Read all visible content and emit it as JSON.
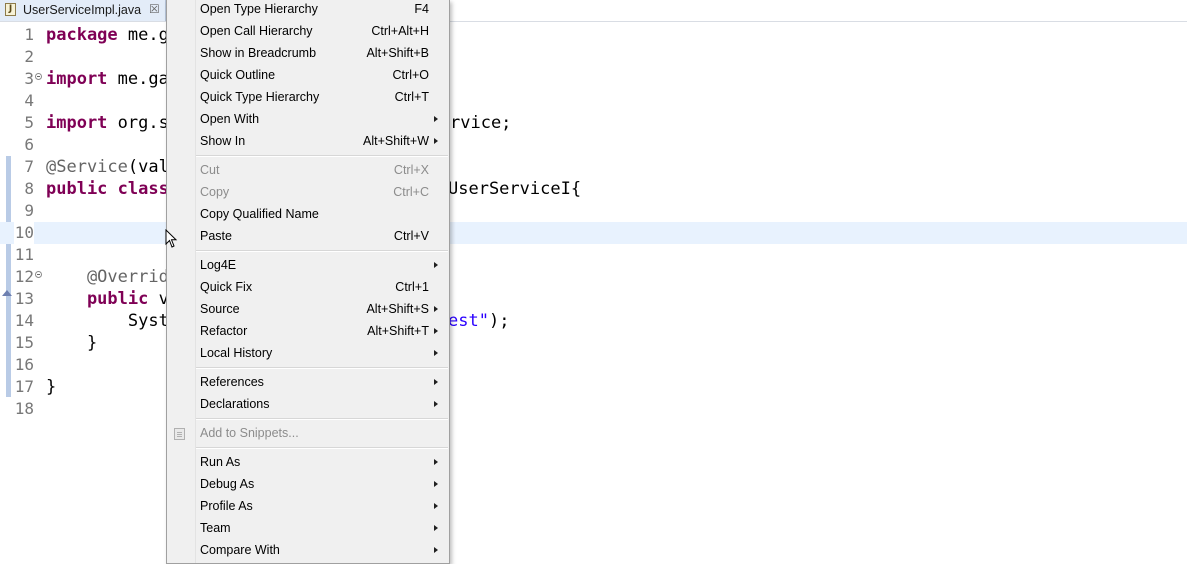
{
  "tab": {
    "label": "UserServiceImpl.java",
    "close_glyph": "☒",
    "file_glyph": "J"
  },
  "lines": [
    {
      "no": "1",
      "prefix": "package",
      "rest": " me.g"
    },
    {
      "no": "2"
    },
    {
      "no": "3",
      "prefix": "import",
      "rest": " me.ga"
    },
    {
      "no": "4"
    },
    {
      "no": "5",
      "prefix": "import",
      "rest": " org.s",
      "tail": "rvice;"
    },
    {
      "no": "6"
    },
    {
      "no": "7",
      "ann": "@Service",
      "rest": "(val"
    },
    {
      "no": "8",
      "prefix": "public",
      "prefix2": " class",
      "tail": "UserServiceI{"
    },
    {
      "no": "9"
    },
    {
      "no": "10"
    },
    {
      "no": "11"
    },
    {
      "no": "12",
      "ann": "    @Overrid"
    },
    {
      "no": "13",
      "prefix": "    public",
      "rest": " v"
    },
    {
      "no": "14",
      "rest": "        Syst",
      "tail_str": "est\"",
      "tail": ");"
    },
    {
      "no": "15",
      "rest": "    }"
    },
    {
      "no": "16"
    },
    {
      "no": "17",
      "rest": "}"
    },
    {
      "no": "18"
    }
  ],
  "menu": {
    "open_type_hierarchy": {
      "label": "Open Type Hierarchy",
      "shortcut": "F4"
    },
    "open_call_hierarchy": {
      "label": "Open Call Hierarchy",
      "shortcut": "Ctrl+Alt+H"
    },
    "show_in_breadcrumb": {
      "label": "Show in Breadcrumb",
      "shortcut": "Alt+Shift+B"
    },
    "quick_outline": {
      "label": "Quick Outline",
      "shortcut": "Ctrl+O"
    },
    "quick_type_hierarchy": {
      "label": "Quick Type Hierarchy",
      "shortcut": "Ctrl+T"
    },
    "open_with": {
      "label": "Open With"
    },
    "show_in": {
      "label": "Show In",
      "shortcut": "Alt+Shift+W"
    },
    "cut": {
      "label": "Cut",
      "shortcut": "Ctrl+X"
    },
    "copy": {
      "label": "Copy",
      "shortcut": "Ctrl+C"
    },
    "copy_qualified_name": {
      "label": "Copy Qualified Name"
    },
    "paste": {
      "label": "Paste",
      "shortcut": "Ctrl+V"
    },
    "log4e": {
      "label": "Log4E"
    },
    "quick_fix": {
      "label": "Quick Fix",
      "shortcut": "Ctrl+1"
    },
    "source": {
      "label": "Source",
      "shortcut": "Alt+Shift+S"
    },
    "refactor": {
      "label": "Refactor",
      "shortcut": "Alt+Shift+T"
    },
    "local_history": {
      "label": "Local History"
    },
    "references": {
      "label": "References"
    },
    "declarations": {
      "label": "Declarations"
    },
    "add_to_snippets": {
      "label": "Add to Snippets..."
    },
    "run_as": {
      "label": "Run As"
    },
    "debug_as": {
      "label": "Debug As"
    },
    "profile_as": {
      "label": "Profile As"
    },
    "team": {
      "label": "Team"
    },
    "compare_with": {
      "label": "Compare With"
    }
  },
  "colors": {
    "keyword": "#7f0055",
    "annotation": "#646464",
    "string": "#2a00ff",
    "current_line": "#e8f2fe",
    "menu_bg": "#f0f0f0"
  }
}
